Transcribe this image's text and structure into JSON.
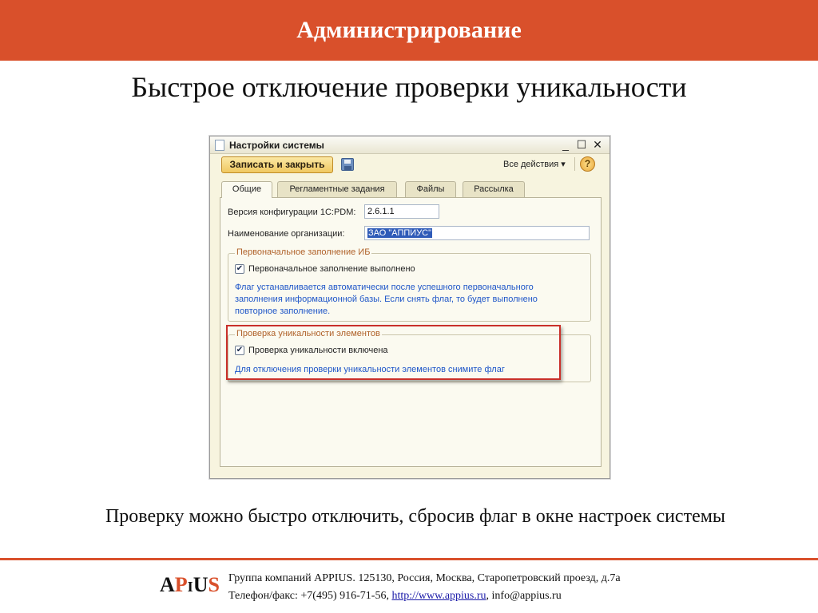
{
  "header": {
    "title": "Администрирование"
  },
  "slide_title": "Быстрое отключение проверки уникальности",
  "window": {
    "title": "Настройки системы",
    "controls": {
      "minimize": "_",
      "maximize": "☐",
      "close": "✕"
    },
    "toolbar": {
      "save_close": "Записать и закрыть",
      "all_actions": "Все действия ▾",
      "help": "?"
    },
    "tabs": [
      {
        "label": "Общие",
        "active": true
      },
      {
        "label": "Регламентные задания",
        "active": false
      },
      {
        "label": "Файлы",
        "active": false
      },
      {
        "label": "Рассылка",
        "active": false
      }
    ],
    "fields": {
      "config_version_label": "Версия конфигурации 1С:PDM:",
      "config_version_value": "2.6.1.1",
      "org_name_label": "Наименование организации:",
      "org_name_value": "ЗАО \"АППИУС\""
    },
    "group_initial": {
      "title": "Первоначальное заполнение ИБ",
      "checkbox_label": "Первоначальное заполнение выполнено",
      "checked": true,
      "hint_lines": [
        "Флаг устанавливается автоматически после успешного первоначального",
        "заполнения информационной базы. Если снять флаг, то будет выполнено",
        "повторное заполнение."
      ]
    },
    "group_unique": {
      "title": "Проверка уникальности элементов",
      "checkbox_label": "Проверка уникальности включена",
      "checked": true,
      "hint": "Для отключения проверки уникальности элементов снимите флаг"
    }
  },
  "caption": "Проверку можно быстро отключить, сбросив флаг в окне настроек системы",
  "footer": {
    "logo_text": "APPIUS",
    "line1": "Группа компаний APPIUS. 125130, Россия, Москва, Старопетровский проезд, д.7а",
    "line2_prefix": "Телефон/факс: +7(495) 916-71-56, ",
    "link": "http://www.appius.ru",
    "line2_suffix": ", info@appius.ru"
  },
  "colors": {
    "accent": "#d9502b",
    "hint_blue": "#1f56c8",
    "highlight_red": "#c9302a"
  }
}
